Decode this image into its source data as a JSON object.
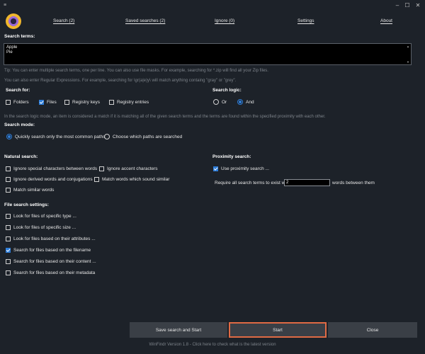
{
  "window": {
    "menu_icon": "hamburger-icon",
    "controls": {
      "minimize": "–",
      "maximize": "☐",
      "close": "✕"
    }
  },
  "tabs": [
    {
      "label": "Search (2)"
    },
    {
      "label": "Saved searches (2)"
    },
    {
      "label": "Ignore (0)"
    },
    {
      "label": "Settings"
    },
    {
      "label": "About"
    }
  ],
  "search_terms": {
    "title": "Search terms:",
    "lines": [
      "Apple",
      "Pie"
    ],
    "tip1": "Tip: You can enter multiple search terms, one per line. You can also use file masks. For example, searching for *.zip will find all your Zip files.",
    "tip2": "You can also enter Regular Expressions. For example, searching for \\gr(a|e)y\\ will match anything containg \"gray\" or \"grey\"."
  },
  "search_for": {
    "title": "Search for:",
    "items": [
      {
        "label": "Folders",
        "checked": false
      },
      {
        "label": "Files",
        "checked": true
      },
      {
        "label": "Registry keys",
        "checked": false
      },
      {
        "label": "Registry entries",
        "checked": false
      }
    ]
  },
  "search_logic": {
    "title": "Search logic:",
    "options": [
      {
        "label": "Or",
        "selected": false
      },
      {
        "label": "And",
        "selected": true
      }
    ],
    "hint": "In the search logic mode, an item is considered a match if it is matching all of the given search terms and the terms are found within the specified proximity with each other."
  },
  "search_mode": {
    "title": "Search mode:",
    "options": [
      {
        "label": "Quickly search only the most common paths",
        "selected": true
      },
      {
        "label": "Choose which paths are searched",
        "selected": false
      }
    ]
  },
  "natural_search": {
    "title": "Natural search:",
    "items": [
      {
        "label": "Ignore special characters between words",
        "checked": false
      },
      {
        "label": "Ignore accent characters",
        "checked": false
      },
      {
        "label": "Ignore derived words and conjugations",
        "checked": false
      },
      {
        "label": "Match words which sound similar",
        "checked": false
      },
      {
        "label": "Match similar words",
        "checked": false
      }
    ]
  },
  "proximity_search": {
    "title": "Proximity search:",
    "use_label": "Use proximity search ...",
    "use_checked": true,
    "require_label": "Require all search terms to exist with at most",
    "value": "2",
    "suffix": "words between them"
  },
  "file_settings": {
    "title": "File search settings:",
    "items": [
      {
        "label": "Look for files of specific type ...",
        "checked": false
      },
      {
        "label": "Look for files of specific size ...",
        "checked": false
      },
      {
        "label": "Look for files based on their attributes ...",
        "checked": false
      },
      {
        "label": "Search for files based on the filename",
        "checked": true
      },
      {
        "label": "Search for files based on their content ...",
        "checked": false
      },
      {
        "label": "Search for files based on their metadata",
        "checked": false
      }
    ]
  },
  "buttons": {
    "save_start": "Save search and Start",
    "start": "Start",
    "close": "Close"
  },
  "footer": "WinFindr Version 1.8 - Click here to check what is the latest version",
  "colors": {
    "accent": "#2e7dd8",
    "highlight": "#e06a44",
    "background": "#1d2229"
  }
}
